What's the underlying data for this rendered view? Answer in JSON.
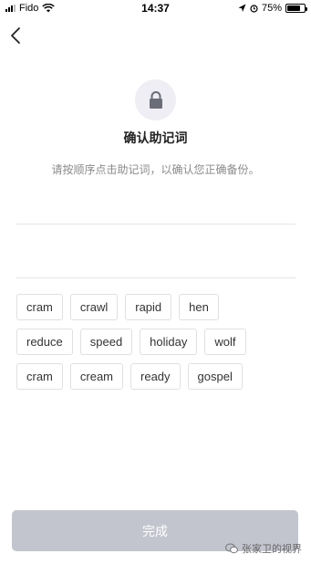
{
  "status_bar": {
    "carrier": "Fido",
    "time": "14:37",
    "battery": "75%",
    "battery_level": 0.75
  },
  "header": {
    "title": "确认助记词",
    "subtitle": "请按顺序点击助记词，以确认您正确备份。"
  },
  "answer_area": {
    "selected_words": []
  },
  "word_rows": [
    [
      "cram",
      "crawl",
      "rapid",
      "hen"
    ],
    [
      "reduce",
      "speed",
      "holiday",
      "wolf"
    ],
    [
      "cram",
      "cream",
      "ready",
      "gospel"
    ]
  ],
  "footer": {
    "done_label": "完成"
  },
  "watermark": {
    "text": "张家卫的视界"
  },
  "colors": {
    "button_disabled": "#c3c5ce",
    "lock_bg": "#eeeef4",
    "chip_border": "#e0e0e4"
  }
}
